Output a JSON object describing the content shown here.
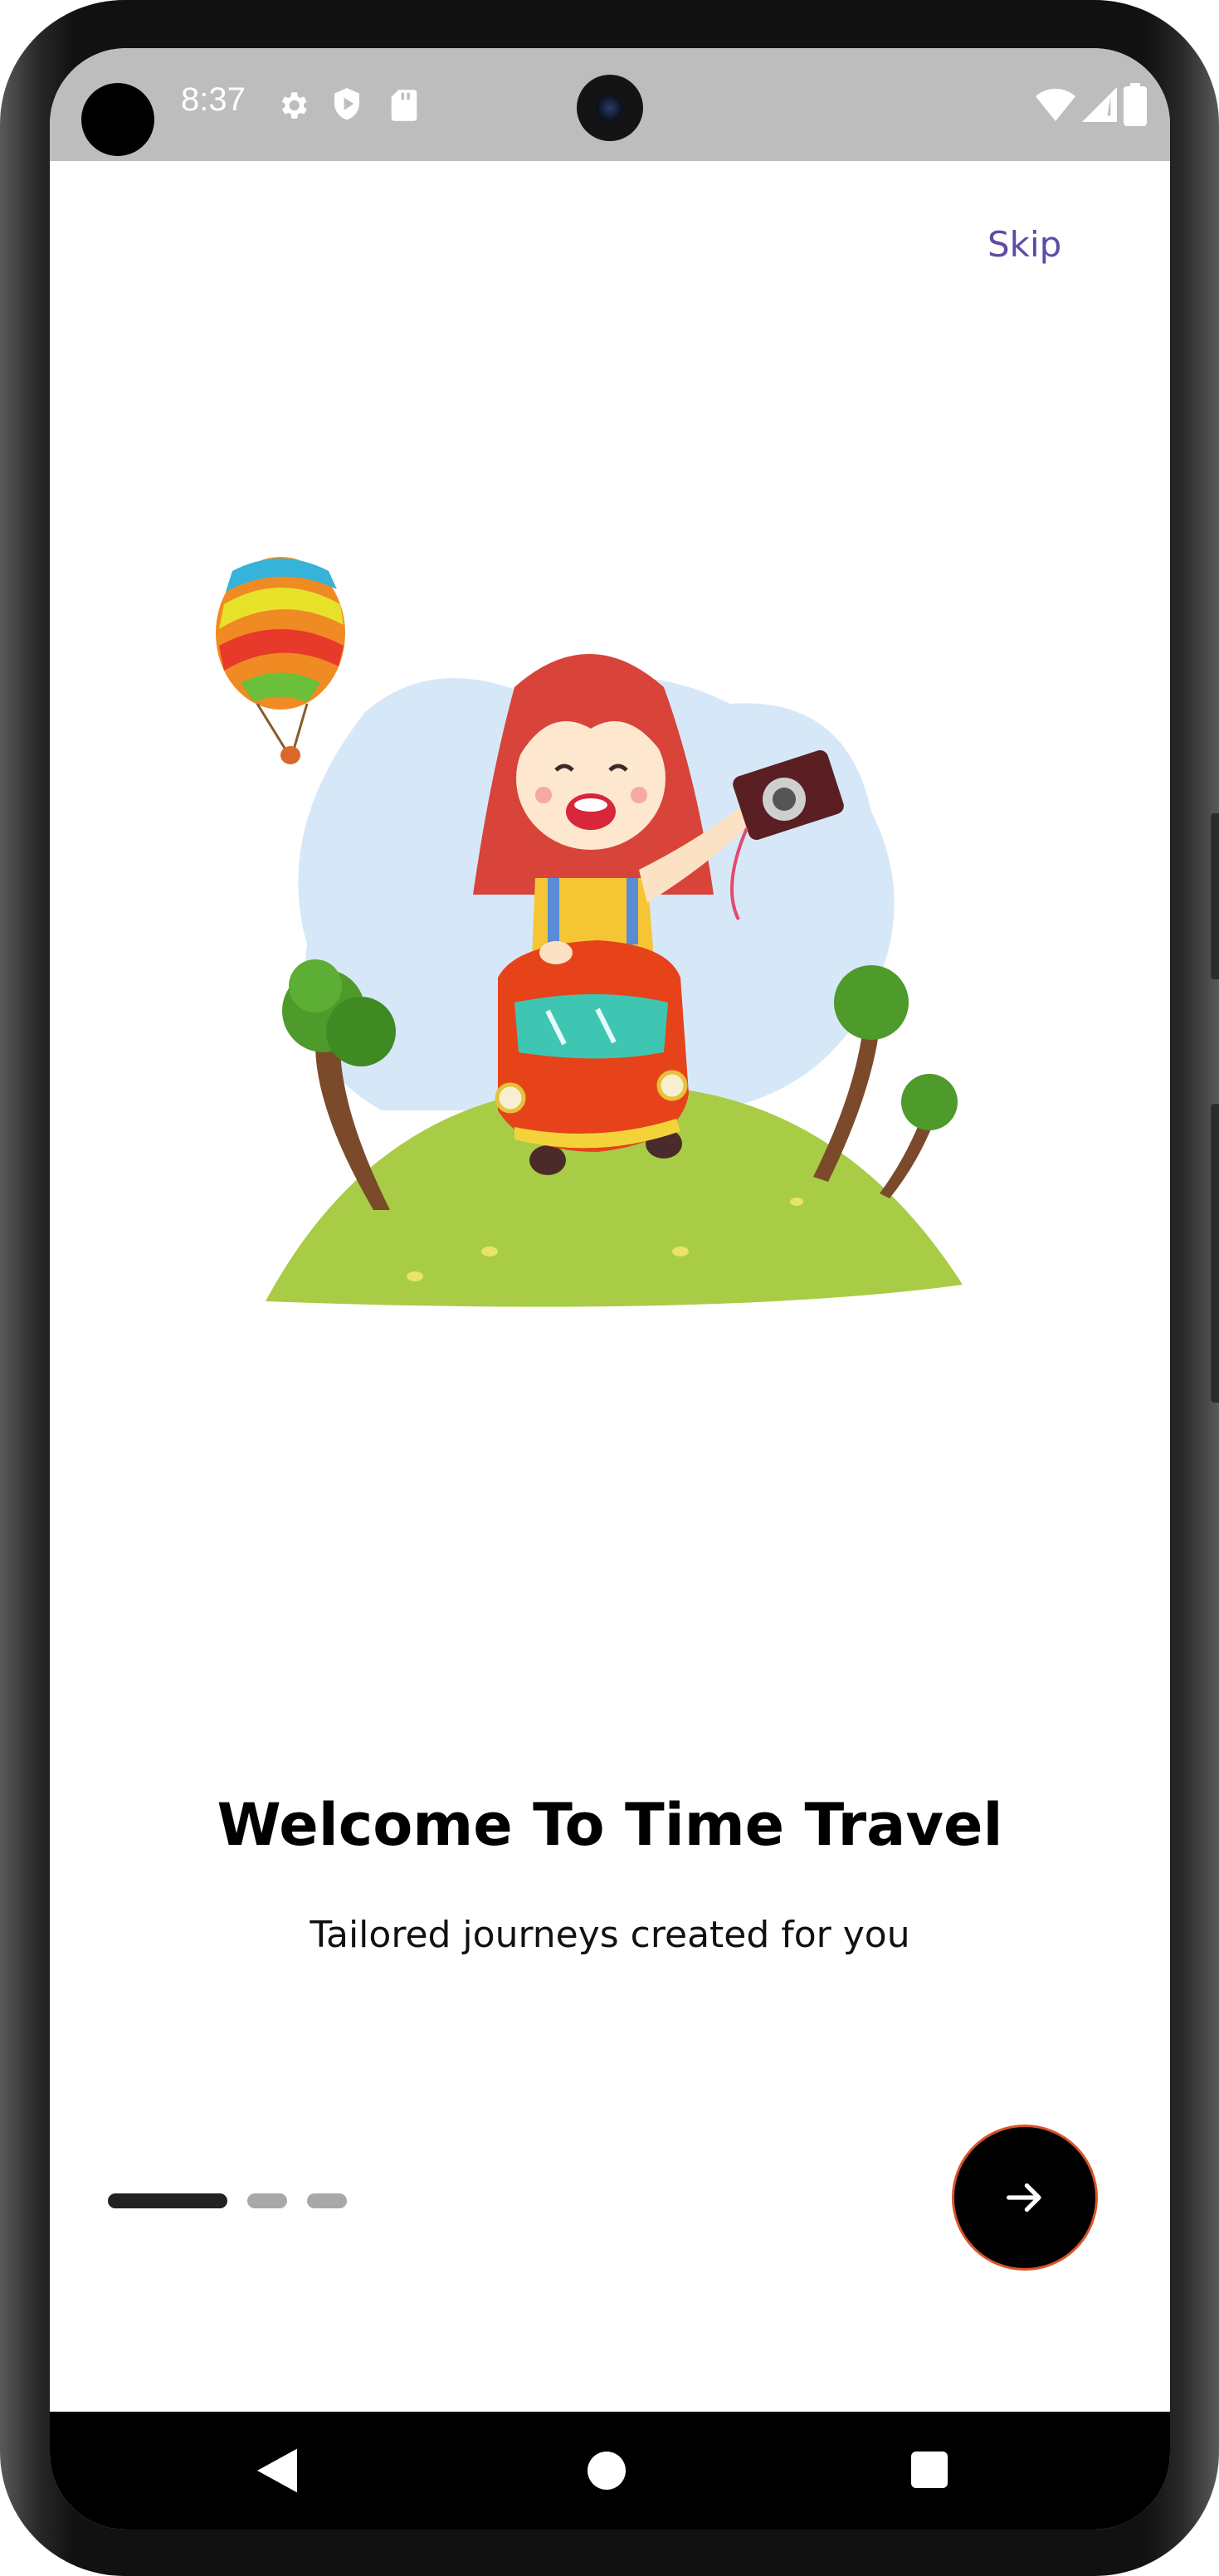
{
  "status_bar": {
    "time": "8:37",
    "icons_left": [
      "settings-gear-icon",
      "shield-play-icon",
      "sd-card-icon"
    ],
    "icons_right": [
      "wifi-icon",
      "cell-signal-icon",
      "battery-icon"
    ]
  },
  "header": {
    "skip_label": "Skip",
    "skip_color": "#5e4aa6"
  },
  "onboarding": {
    "illustration": "girl-in-red-car-with-camera-and-balloon-illustration",
    "title": "Welcome To Time Travel",
    "subtitle": "Tailored journeys created for you",
    "page_index": 1,
    "page_count": 3,
    "next_button_icon": "arrow-right-icon",
    "next_button_border_color": "#d9532b"
  },
  "nav_bar": {
    "buttons": [
      "back-icon",
      "home-icon",
      "recents-icon"
    ]
  }
}
